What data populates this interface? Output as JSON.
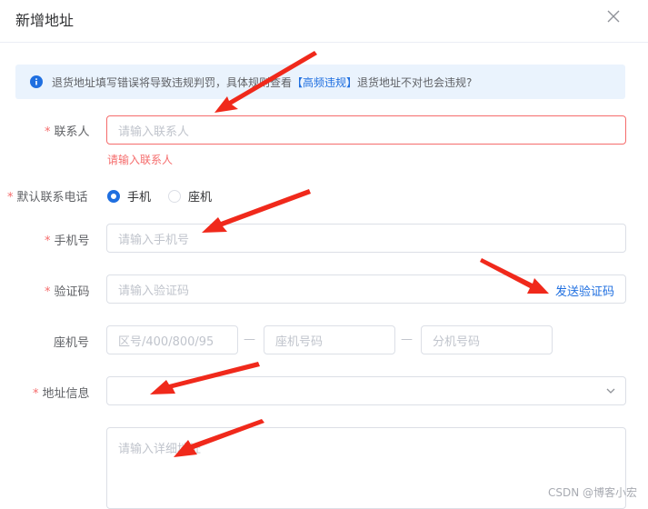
{
  "dialog": {
    "title": "新增地址"
  },
  "alert": {
    "prefix": "退货地址填写错误将导致违规判罚，具体规则查看",
    "link": "【高频违规】",
    "suffix": "退货地址不对也会违规?"
  },
  "form": {
    "contact": {
      "label": "联系人",
      "placeholder": "请输入联系人",
      "error": "请输入联系人"
    },
    "default_phone": {
      "label": "默认联系电话",
      "options": [
        "手机",
        "座机"
      ],
      "selected": "手机"
    },
    "mobile": {
      "label": "手机号",
      "placeholder": "请输入手机号"
    },
    "code": {
      "label": "验证码",
      "placeholder": "请输入验证码",
      "send_label": "发送验证码"
    },
    "landline": {
      "label": "座机号",
      "area_placeholder": "区号/400/800/95",
      "number_placeholder": "座机号码",
      "ext_placeholder": "分机号码",
      "separator": "—"
    },
    "address": {
      "label": "地址信息",
      "select_value": "",
      "detail_placeholder": "请输入详细地址"
    }
  },
  "watermark": "CSDN @博客小宏",
  "colors": {
    "accent": "#1f6fe0",
    "error": "#f56c6c",
    "alert_bg": "#eaf3fd",
    "annotation_arrow": "#f0291b"
  }
}
